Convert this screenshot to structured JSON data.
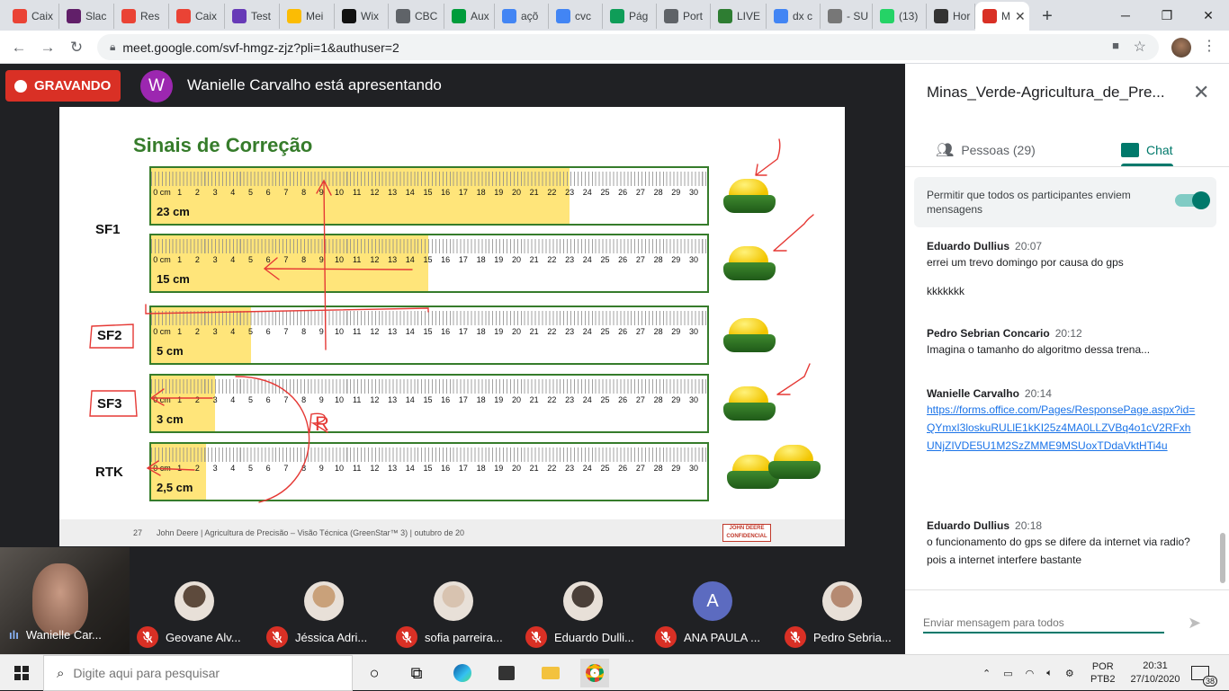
{
  "browser": {
    "tabs": [
      {
        "label": "Caix",
        "icon": "gmail-icon",
        "color": "#ea4335"
      },
      {
        "label": "Slac",
        "icon": "slack-icon",
        "color": "#611f69"
      },
      {
        "label": "Res",
        "icon": "gmail-icon",
        "color": "#ea4335"
      },
      {
        "label": "Caix",
        "icon": "gmail-icon",
        "color": "#ea4335"
      },
      {
        "label": "Test",
        "icon": "forms-icon",
        "color": "#673ab7"
      },
      {
        "label": "Mei",
        "icon": "drive-icon",
        "color": "#fbbc04"
      },
      {
        "label": "Wix",
        "icon": "wix-icon",
        "color": "#111111"
      },
      {
        "label": "CBC",
        "icon": "globe-icon",
        "color": "#5f6368"
      },
      {
        "label": "Aux",
        "icon": "flag-icon",
        "color": "#009c3b"
      },
      {
        "label": "açõ",
        "icon": "google-icon",
        "color": "#4285f4"
      },
      {
        "label": "cvc",
        "icon": "google-icon",
        "color": "#4285f4"
      },
      {
        "label": "Pág",
        "icon": "edge-icon",
        "color": "#0f9d58"
      },
      {
        "label": "Port",
        "icon": "globe-icon",
        "color": "#5f6368"
      },
      {
        "label": "LIVE",
        "icon": "leaf-icon",
        "color": "#2e7d32"
      },
      {
        "label": "dx c",
        "icon": "google-icon",
        "color": "#4285f4"
      },
      {
        "label": "- SU",
        "icon": "suap-icon",
        "color": "#777777"
      },
      {
        "label": "(13)",
        "icon": "whatsapp-icon",
        "color": "#25d366"
      },
      {
        "label": "Hor",
        "icon": "wg-icon",
        "color": "#333333"
      },
      {
        "label": "M",
        "icon": "recording-icon",
        "color": "#d93025"
      }
    ],
    "new_tab_symbol": "+",
    "window": {
      "minimize": "─",
      "maximize": "❐",
      "close": "✕"
    },
    "url": "meet.google.com/svf-hmgz-zjz?pli=1&authuser=2"
  },
  "meet": {
    "recording_label": "GRAVANDO",
    "presenter_initial": "W",
    "presenting_text": "Wanielle Carvalho está apresentando",
    "slide": {
      "title": "Sinais de Correção",
      "rows": [
        {
          "group": "SF1",
          "cm_label": "23 cm",
          "fill_cm": 23
        },
        {
          "group": "",
          "cm_label": "15 cm",
          "fill_cm": 15
        },
        {
          "group": "SF2",
          "cm_label": "5 cm",
          "fill_cm": 5
        },
        {
          "group": "SF3",
          "cm_label": "3 cm",
          "fill_cm": 3
        },
        {
          "group": "RTK",
          "cm_label": "2,5 cm",
          "fill_cm": 2.5
        }
      ],
      "annotation_letter": "R",
      "footer_page": "27",
      "footer_text": "John Deere | Agricultura de Precisão – Visão Técnica (GreenStar™ 3) | outubro de 20",
      "logo_line1": "JOHN DEERE",
      "logo_line2": "CONFIDENCIAL"
    },
    "self_tile": {
      "name": "Wanielle Car..."
    },
    "participants": [
      {
        "name": "Geovane Alv...",
        "avatar": "photo",
        "color": "#5d4a3c"
      },
      {
        "name": "Jéssica Adri...",
        "avatar": "photo",
        "color": "#c9a17a"
      },
      {
        "name": "sofia parreira...",
        "avatar": "photo",
        "color": "#d8c3b0"
      },
      {
        "name": "Eduardo Dulli...",
        "avatar": "photo",
        "color": "#4a3f38"
      },
      {
        "name": "ANA PAULA ...",
        "avatar": "A",
        "color": "#5c6bc0"
      },
      {
        "name": "Pedro Sebria...",
        "avatar": "photo",
        "color": "#b58a72"
      }
    ]
  },
  "panel": {
    "title": "Minas_Verde-Agricultura_de_Pre...",
    "people_tab": "Pessoas (29)",
    "chat_tab": "Chat",
    "allow_text": "Permitir que todos os participantes enviem mensagens",
    "messages": [
      {
        "author": "Eduardo Dullius",
        "time": "20:07",
        "lines": [
          "errei um trevo domingo por causa do gps",
          "",
          "kkkkkkk"
        ]
      },
      {
        "author": "Pedro Sebrian Concario",
        "time": "20:12",
        "lines": [
          "Imagina o tamanho do algoritmo dessa trena..."
        ]
      },
      {
        "author": "Wanielle Carvalho",
        "time": "20:14",
        "link": "https://forms.office.com/Pages/ResponsePage.aspx?id=QYmxI3loskuRULlE1kKI25z4MA0LLZVBq4o1cV2RFxhUNjZIVDE5U1M2SzZMME9MSUoxTDdaVktHTi4u"
      },
      {
        "author": "Eduardo Dullius",
        "time": "20:18",
        "lines": [
          "o funcionamento do gps se difere da internet via radio? pois a internet interfere bastante"
        ]
      }
    ],
    "input_placeholder": "Enviar mensagem para todos"
  },
  "taskbar": {
    "search_placeholder": "Digite aqui para pesquisar",
    "language": "POR",
    "layout": "PTB2",
    "time": "20:31",
    "date": "27/10/2020",
    "notifications": "38"
  }
}
